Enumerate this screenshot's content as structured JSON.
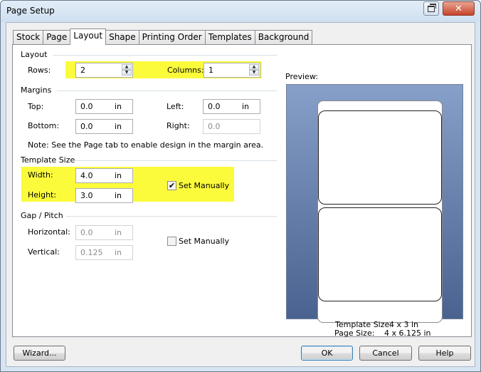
{
  "window": {
    "title": "Page Setup"
  },
  "tabs": [
    "Stock",
    "Page",
    "Layout",
    "Shape",
    "Printing Order",
    "Templates",
    "Background"
  ],
  "active_tab": "Layout",
  "layout": {
    "group_label": "Layout",
    "rows_label": "Rows:",
    "rows_value": "2",
    "columns_label": "Columns:",
    "columns_value": "1"
  },
  "margins": {
    "group_label": "Margins",
    "top_label": "Top:",
    "top_value": "0.0",
    "top_unit": "in",
    "left_label": "Left:",
    "left_value": "0.0",
    "left_unit": "in",
    "bottom_label": "Bottom:",
    "bottom_value": "0.0",
    "bottom_unit": "in",
    "right_label": "Right:",
    "right_value": "0.0",
    "note": "Note: See the Page tab to enable design in the margin area."
  },
  "template_size": {
    "group_label": "Template Size",
    "width_label": "Width:",
    "width_value": "4.0",
    "width_unit": "in",
    "height_label": "Height:",
    "height_value": "3.0",
    "height_unit": "in",
    "set_manually_label": "Set Manually",
    "set_manually_checked": true
  },
  "gap_pitch": {
    "group_label": "Gap / Pitch",
    "horizontal_label": "Horizontal:",
    "horizontal_value": "0.0",
    "horizontal_unit": "in",
    "vertical_label": "Vertical:",
    "vertical_value": "0.125",
    "vertical_unit": "in",
    "set_manually_label": "Set Manually",
    "set_manually_checked": false
  },
  "preview": {
    "label": "Preview:",
    "page_size_label": "Page Size:",
    "page_size_value": "4 x 6.125 in",
    "template_size_label": "Template Size:",
    "template_size_value": "4 x 3 in"
  },
  "buttons": {
    "wizard": "Wizard...",
    "ok": "OK",
    "cancel": "Cancel",
    "help": "Help"
  },
  "colors": {
    "highlight": "#fbfb3c",
    "preview_bg_top": "#86a0c9",
    "preview_bg_bottom": "#4a628f"
  }
}
